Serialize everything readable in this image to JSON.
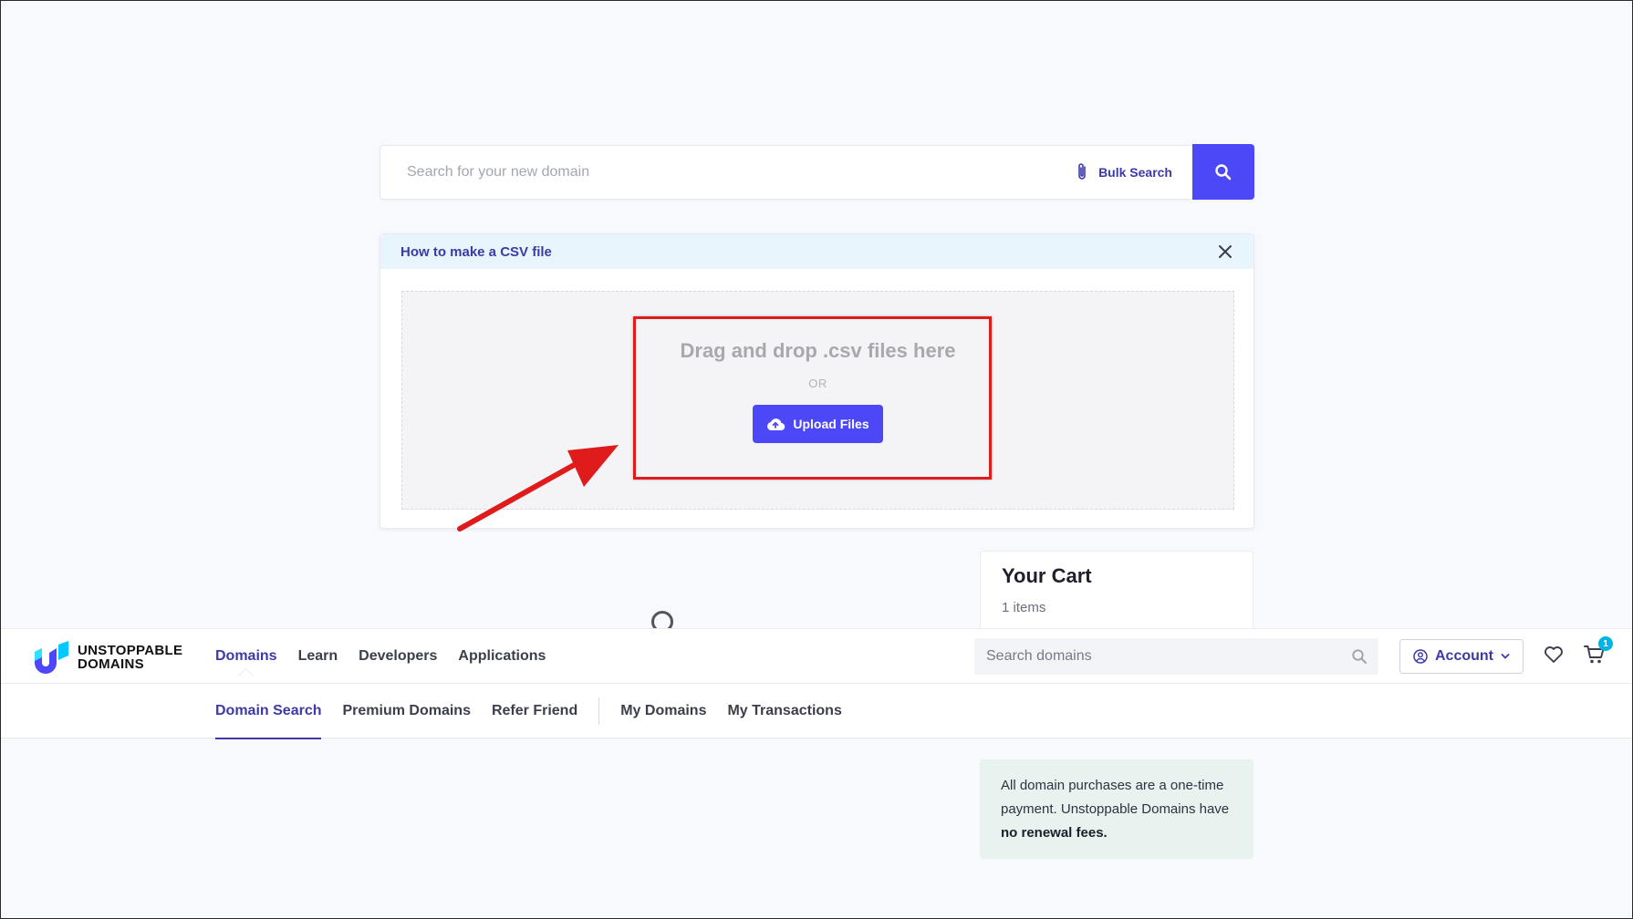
{
  "search": {
    "placeholder": "Search for your new domain",
    "bulk_label": "Bulk Search"
  },
  "csv_help": {
    "link_label": "How to make a CSV file"
  },
  "upload": {
    "drop_title": "Drag and drop .csv files here",
    "or_text": "OR",
    "button_label": "Upload Files"
  },
  "cart": {
    "title": "Your Cart",
    "count": "1 items"
  },
  "logo": {
    "line1": "UNSTOPPABLE",
    "line2": "DOMAINS"
  },
  "nav": {
    "links": [
      "Domains",
      "Learn",
      "Developers",
      "Applications"
    ],
    "search_placeholder": "Search domains",
    "account_label": "Account",
    "cart_badge": "1"
  },
  "subnav": {
    "left_links": [
      "Domain Search",
      "Premium Domains",
      "Refer Friend"
    ],
    "right_links": [
      "My Domains",
      "My Transactions"
    ]
  },
  "notice": {
    "text": "All domain purchases are a one-time payment. Unstoppable Domains have",
    "bold": "no renewal fees."
  },
  "colors": {
    "primary": "#4c47f7",
    "link": "#3d3aa8",
    "annotation_red": "#e01b1b",
    "notice_bg": "#e8f3ef",
    "csv_header_bg": "#e9f5fc"
  }
}
